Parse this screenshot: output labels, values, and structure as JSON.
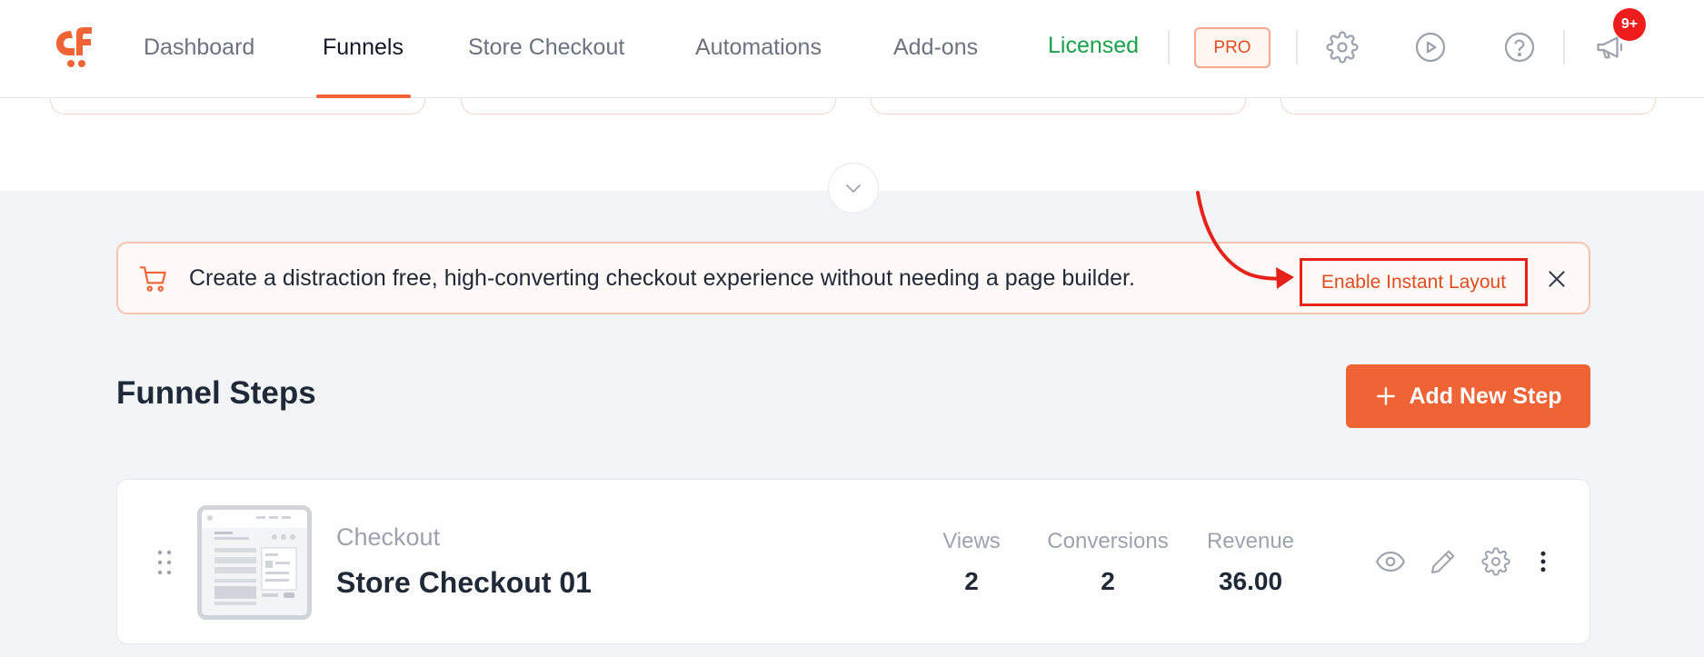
{
  "header": {
    "nav": [
      {
        "label": "Dashboard",
        "active": false
      },
      {
        "label": "Funnels",
        "active": true
      },
      {
        "label": "Store Checkout",
        "active": false
      },
      {
        "label": "Automations",
        "active": false
      },
      {
        "label": "Add-ons",
        "active": false
      }
    ],
    "license_status": "Licensed",
    "pro_label": "PRO",
    "notification_count": "9+",
    "icons": [
      "cartflows-logo-icon",
      "gear-icon",
      "play-icon",
      "help-icon",
      "megaphone-icon"
    ]
  },
  "notice": {
    "text": "Create a distraction free, high-converting checkout experience without needing a page builder.",
    "action_label": "Enable Instant Layout",
    "icon": "cart-icon"
  },
  "section": {
    "title": "Funnel Steps",
    "add_button_label": "Add New Step"
  },
  "steps": [
    {
      "type": "Checkout",
      "name": "Store Checkout 01",
      "stats": [
        {
          "label": "Views",
          "value": "2"
        },
        {
          "label": "Conversions",
          "value": "2"
        },
        {
          "label": "Revenue",
          "value": "36.00"
        }
      ]
    }
  ],
  "colors": {
    "accent": "#f06335",
    "licensed": "#16a34a",
    "badge": "#ef1c1c",
    "annotation": "#e6231b"
  }
}
